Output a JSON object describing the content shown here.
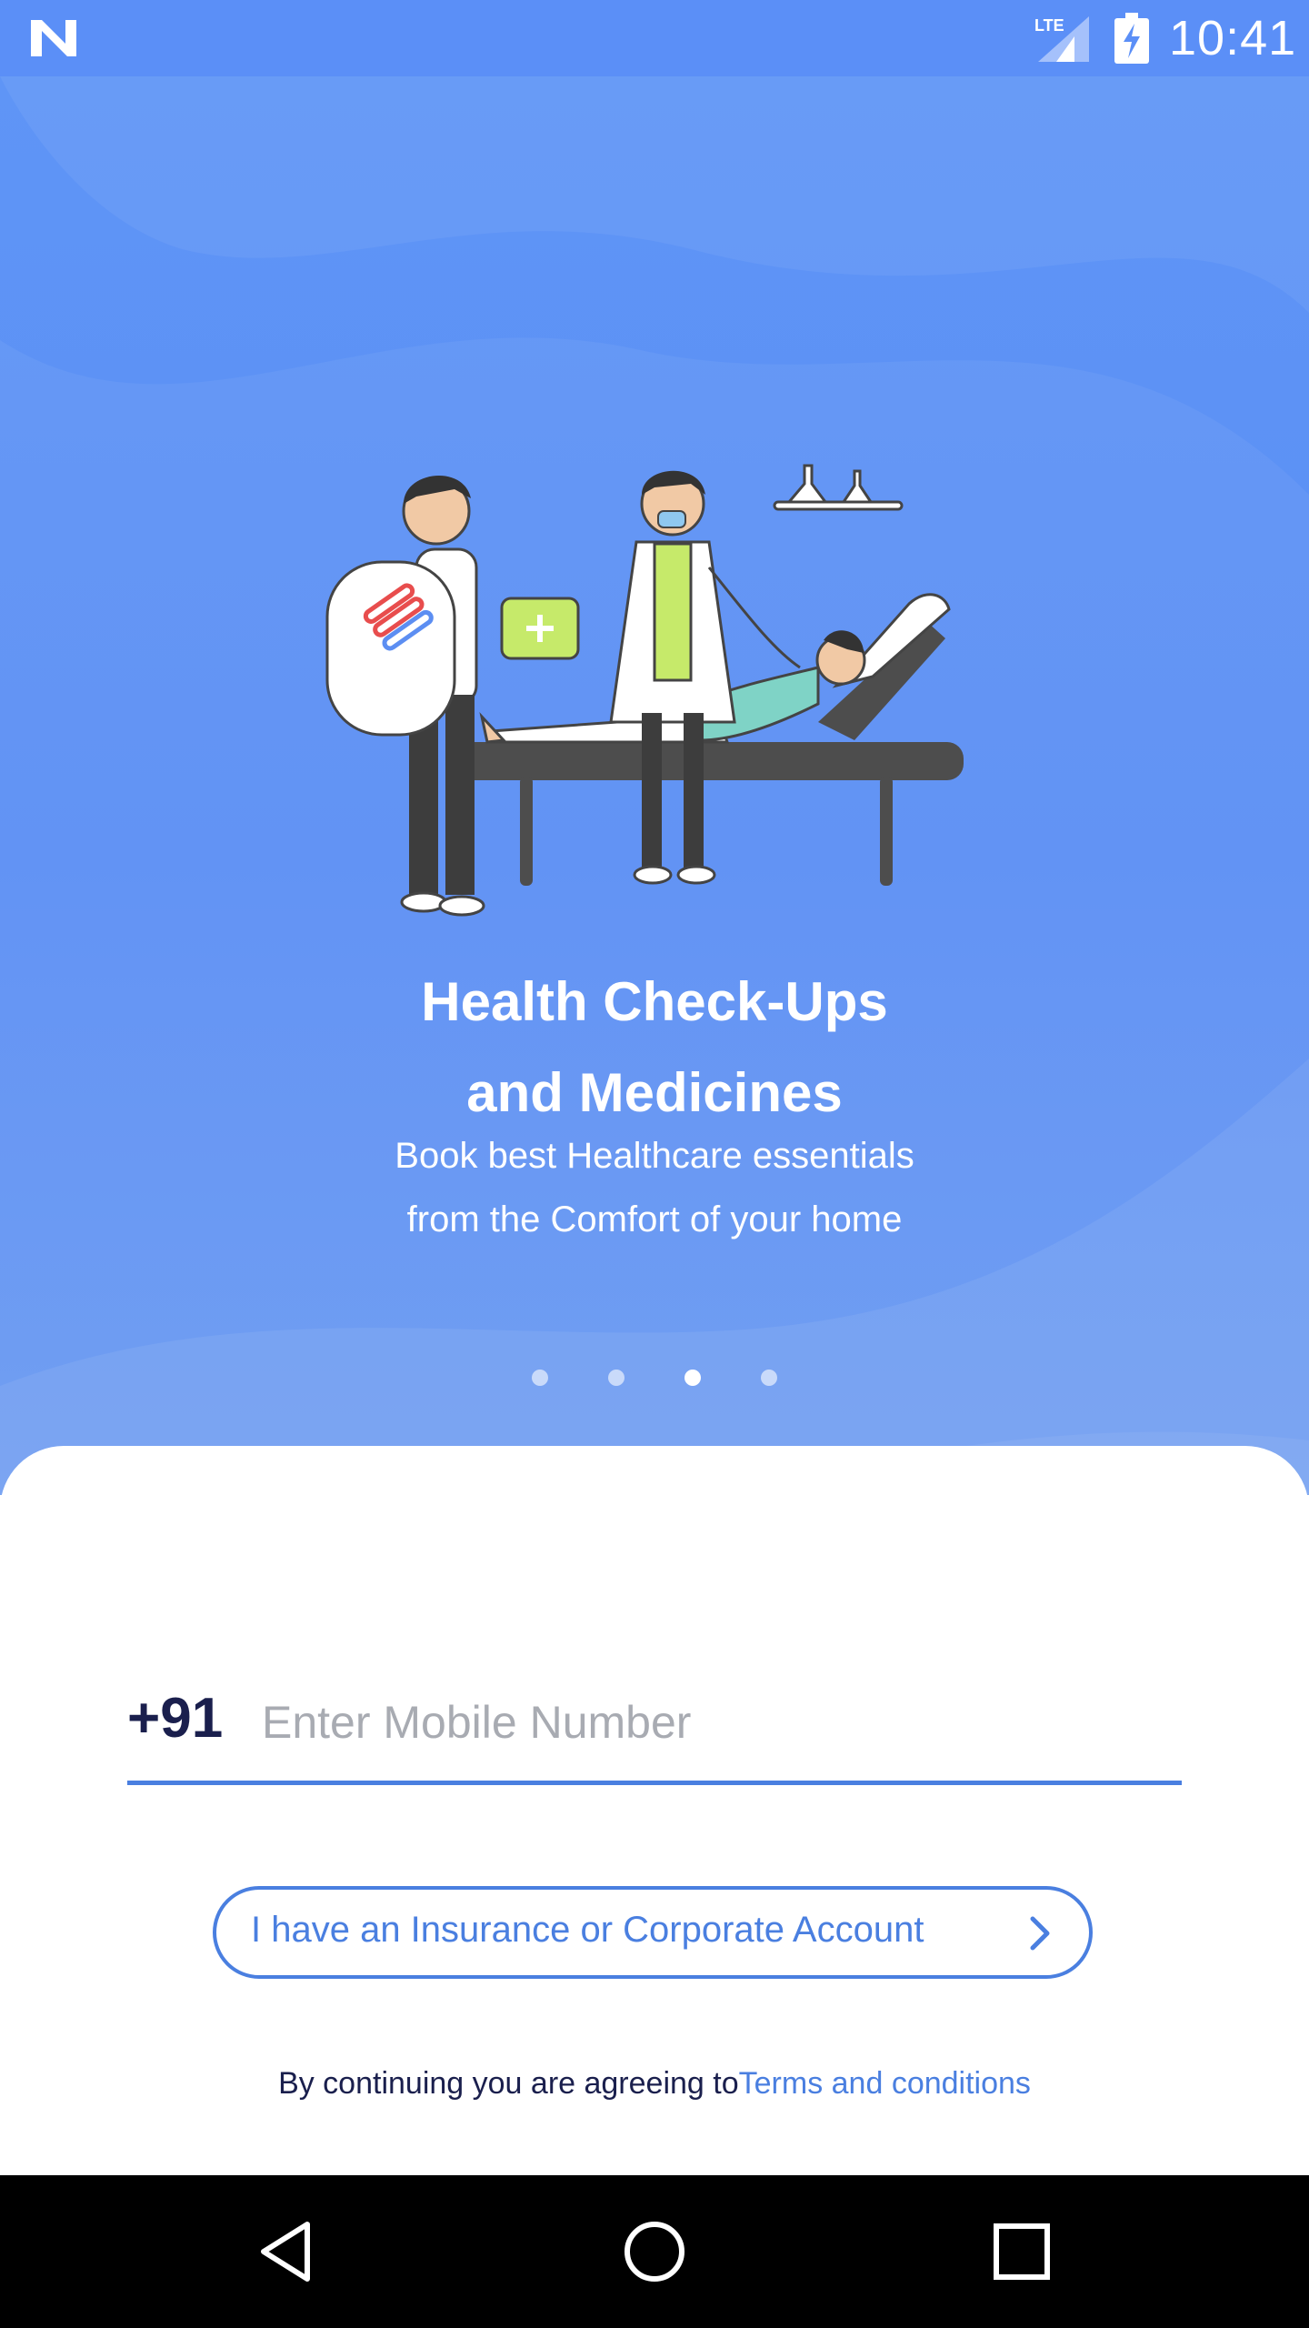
{
  "status_bar": {
    "time": "10:41",
    "network": "LTE"
  },
  "onboarding": {
    "title_line1": "Health Check-Ups",
    "title_line2": "and Medicines",
    "subtitle_line1": "Book best Healthcare essentials",
    "subtitle_line2": "from the Comfort of your home",
    "pagination": {
      "total": 4,
      "active_index": 2
    }
  },
  "login": {
    "country_code": "+91",
    "phone_placeholder": "Enter Mobile Number",
    "phone_value": "",
    "insurance_button": "I have an Insurance or Corporate Account",
    "terms_prefix": "By continuing you are agreeing to",
    "terms_link": "Terms and conditions"
  },
  "colors": {
    "primary": "#4a7fe0",
    "hero_bg": "#5b8ff7",
    "dark_text": "#1a1f4d"
  },
  "icons": {
    "status": [
      "n-logo-icon",
      "lte-signal-icon",
      "battery-charging-icon"
    ],
    "nav": [
      "back-icon",
      "home-icon",
      "recents-icon"
    ],
    "button": "chevron-right-icon"
  }
}
